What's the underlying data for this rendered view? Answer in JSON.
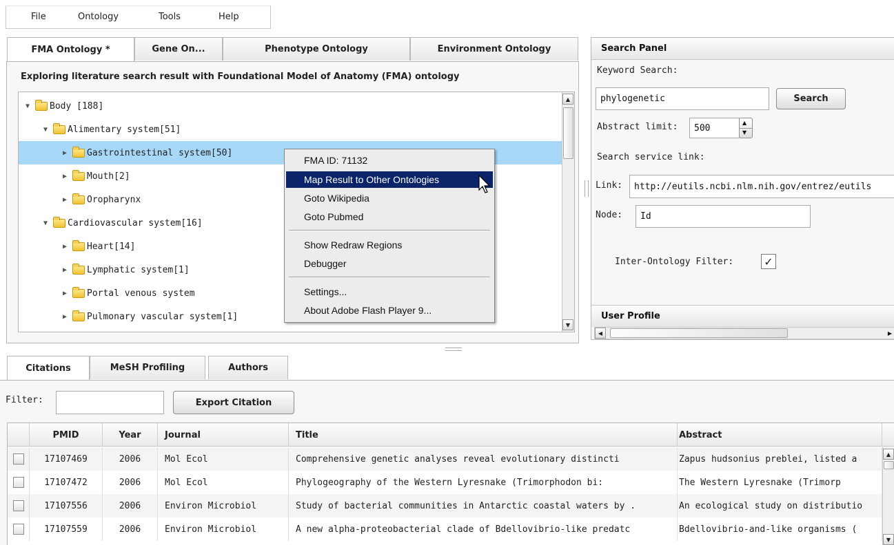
{
  "menubar": {
    "items": [
      "File",
      "Ontology",
      "Tools",
      "Help"
    ]
  },
  "ontology_tabs": [
    {
      "label": "FMA Ontology *",
      "active": true
    },
    {
      "label": "Gene On...",
      "active": false
    },
    {
      "label": "Phenotype Ontology",
      "active": false
    },
    {
      "label": "Environment Ontology",
      "active": false
    }
  ],
  "tree_panel": {
    "heading": "Exploring literature search result with Foundational Model of Anatomy (FMA) ontology",
    "rows": [
      {
        "label": "Body [188]",
        "level": 0,
        "expanded": true
      },
      {
        "label": "Alimentary system[51]",
        "level": 1,
        "expanded": true
      },
      {
        "label": "Gastrointestinal system[50]",
        "level": 2,
        "expanded": false,
        "selected": true
      },
      {
        "label": "Mouth[2]",
        "level": 2,
        "expanded": false
      },
      {
        "label": "Oropharynx",
        "level": 2,
        "expanded": false
      },
      {
        "label": "Cardiovascular system[16]",
        "level": 1,
        "expanded": true
      },
      {
        "label": "Heart[14]",
        "level": 2,
        "expanded": false
      },
      {
        "label": "Lymphatic system[1]",
        "level": 2,
        "expanded": false
      },
      {
        "label": "Portal venous system",
        "level": 2,
        "expanded": false
      },
      {
        "label": "Pulmonary vascular system[1]",
        "level": 2,
        "expanded": false
      }
    ]
  },
  "context_menu": {
    "items": [
      {
        "label": "FMA ID: 71132"
      },
      {
        "label": "Map Result to Other Ontologies",
        "highlighted": true
      },
      {
        "label": "Goto Wikipedia"
      },
      {
        "label": "Goto Pubmed"
      },
      {
        "label": "Show Redraw Regions"
      },
      {
        "label": "Debugger"
      },
      {
        "label": "Settings..."
      },
      {
        "label": "About Adobe Flash Player 9..."
      }
    ]
  },
  "search_panel": {
    "title": "Search Panel",
    "keyword_label": "Keyword Search:",
    "keyword_value": "phylogenetic",
    "search_button": "Search",
    "abstract_limit_label": "Abstract limit:",
    "abstract_limit_value": "500",
    "service_link_label": "Search service link:",
    "link_label": "Link:",
    "link_value": "http://eutils.ncbi.nlm.nih.gov/entrez/eutils",
    "node_label": "Node:",
    "node_value": "Id",
    "filter_label": "Inter-Ontology Filter:",
    "filter_checked": true,
    "user_profile_title": "User Profile"
  },
  "bottom_tabs": [
    {
      "label": "Citations",
      "active": true
    },
    {
      "label": "MeSH Profiling",
      "active": false
    },
    {
      "label": "Authors",
      "active": false
    }
  ],
  "citations": {
    "filter_label": "Filter:",
    "filter_value": "",
    "export_button": "Export Citation",
    "columns": [
      "PMID",
      "Year",
      "Journal",
      "Title",
      "Abstract"
    ],
    "rows": [
      {
        "pmid": "17107469",
        "year": "2006",
        "journal": "Mol Ecol",
        "title": "Comprehensive genetic analyses reveal evolutionary distincti",
        "abstract": "Zapus hudsonius preblei, listed a"
      },
      {
        "pmid": "17107472",
        "year": "2006",
        "journal": "Mol Ecol",
        "title": "Phylogeography of the Western Lyresnake (Trimorphodon bi:",
        "abstract": "The Western Lyresnake (Trimorp"
      },
      {
        "pmid": "17107556",
        "year": "2006",
        "journal": "Environ Microbiol",
        "title": "Study of bacterial communities in Antarctic coastal waters by .",
        "abstract": "An ecological study on distributio"
      },
      {
        "pmid": "17107559",
        "year": "2006",
        "journal": "Environ Microbiol",
        "title": "A new alpha-proteobacterial clade of Bdellovibrio-like predatc",
        "abstract": "Bdellovibrio-and-like organisms ("
      }
    ]
  },
  "colors": {
    "selection": "#a8d8f8",
    "menu_highlight": "#0a246a"
  }
}
